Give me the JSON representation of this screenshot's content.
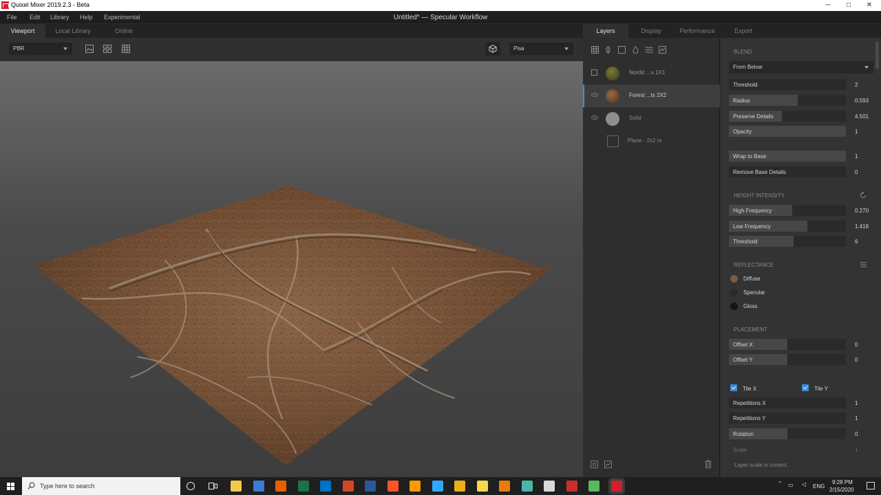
{
  "window": {
    "app_title": "Quixel Mixer 2019.2.3 - Beta",
    "doc_title": "Untitled* — Specular Workflow",
    "controls": {
      "minimize": "─",
      "maximize": "□",
      "close": "✕"
    }
  },
  "menu": [
    "File",
    "Edit",
    "Library",
    "Help",
    "Experimental"
  ],
  "left_tabs": [
    "Viewport",
    "Local Library",
    "Online"
  ],
  "toolbar": {
    "mode_select": "PBR",
    "environment_select": "Pisa",
    "icons": [
      "image-icon",
      "grid-2x2-icon",
      "grid-3x3-icon",
      "cube-icon"
    ]
  },
  "panel_tabs": [
    "Layers",
    "Display",
    "Performance",
    "Export"
  ],
  "layer_toolbar_icons": [
    "texture-icon",
    "leaf-icon",
    "square-icon",
    "drop-icon",
    "waves-icon",
    "filter-icon"
  ],
  "layers": [
    {
      "name": "Nordic ...s 1X1",
      "control": "checkbox",
      "thumb": "#5a5a2a"
    },
    {
      "name": "Forest ...ts 2X2",
      "control": "eye",
      "thumb": "#6d4a32",
      "selected": true
    },
    {
      "name": "Solid",
      "control": "eye",
      "thumb": "#8a8a8a"
    },
    {
      "name": "Plane - 2x2 m",
      "control": "none",
      "thumb": "#2e2e2e"
    }
  ],
  "blend": {
    "label": "BLEND",
    "mode": "From Below",
    "props": [
      {
        "label": "Threshold",
        "value": "2",
        "level": 0
      },
      {
        "label": "Radius",
        "value": "0.593",
        "level": 0.59
      },
      {
        "label": "Preserve Details",
        "value": "4.501",
        "level": 0.45
      },
      {
        "label": "Opacity",
        "value": "1",
        "level": 1
      },
      {
        "label": "Wrap to Base",
        "value": "1",
        "level": 1
      },
      {
        "label": "Remove Base Details",
        "value": "0",
        "level": 0
      }
    ]
  },
  "height_intensity": {
    "label": "HEIGHT INTENSITY",
    "props": [
      {
        "label": "High Frequency",
        "value": "0.270",
        "level": 0.54
      },
      {
        "label": "Low Frequency",
        "value": "1.418",
        "level": 0.67
      },
      {
        "label": "Threshold",
        "value": "6",
        "level": 0.55
      }
    ]
  },
  "reflectance": {
    "label": "REFLECTANCE",
    "items": [
      {
        "label": "Diffuse",
        "color": "#7a5a40"
      },
      {
        "label": "Specular",
        "color": "#2a2a2a"
      },
      {
        "label": "Gloss",
        "color": "#151515"
      }
    ]
  },
  "placement": {
    "label": "PLACEMENT",
    "offsets": [
      {
        "label": "Offset X",
        "value": "0",
        "level": 0.5
      },
      {
        "label": "Offset Y",
        "value": "0",
        "level": 0.5
      }
    ],
    "tile_x": "Tile X",
    "tile_y": "Tile Y",
    "props": [
      {
        "label": "Repetitions X",
        "value": "1",
        "level": 0
      },
      {
        "label": "Repetitions Y",
        "value": "1",
        "level": 0
      },
      {
        "label": "Rotation",
        "value": "0",
        "level": 0.5
      }
    ],
    "scale_label": "Scale",
    "scale_value": "1",
    "status": "Layer scale is correct."
  },
  "taskbar": {
    "search_placeholder": "Type here to search",
    "lang": "ENG",
    "time": "9:28 PM",
    "date": "2/15/2020",
    "apps": [
      {
        "name": "file-explorer-icon",
        "color": "#f2c94c"
      },
      {
        "name": "store-icon",
        "color": "#3a7bd5"
      },
      {
        "name": "firefox-icon",
        "color": "#e66000"
      },
      {
        "name": "excel-icon",
        "color": "#1e7145"
      },
      {
        "name": "outlook-icon",
        "color": "#0072c6"
      },
      {
        "name": "powerpoint-icon",
        "color": "#d24726"
      },
      {
        "name": "word-icon",
        "color": "#2b579a"
      },
      {
        "name": "brave-icon",
        "color": "#fb542b"
      },
      {
        "name": "illustrator-icon",
        "color": "#ff9a00"
      },
      {
        "name": "photoshop-icon",
        "color": "#31a8ff"
      },
      {
        "name": "chrome-icon",
        "color": "#e8b01a"
      },
      {
        "name": "notes-icon",
        "color": "#f7d94c"
      },
      {
        "name": "blender-icon",
        "color": "#e87d0d"
      },
      {
        "name": "m-app-icon",
        "color": "#49b6a9"
      },
      {
        "name": "unreal-icon",
        "color": "#d9d9d9"
      },
      {
        "name": "substance-icon",
        "color": "#c9302c"
      },
      {
        "name": "bridge-icon",
        "color": "#5cb85c"
      },
      {
        "name": "mixer-icon",
        "color": "#d0202f"
      }
    ]
  }
}
